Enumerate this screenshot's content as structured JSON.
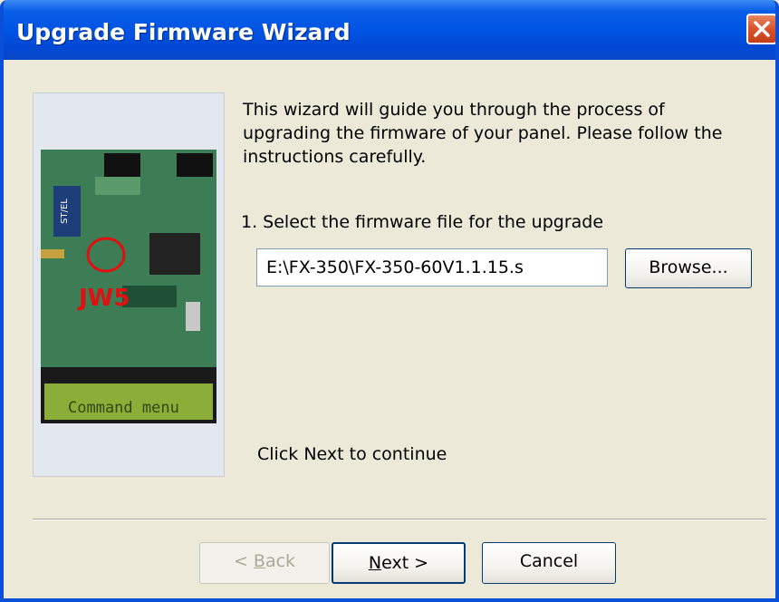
{
  "window": {
    "title": "Upgrade Firmware Wizard"
  },
  "intro": {
    "text": "This wizard will guide you through the process of upgrading the firmware of your panel. Please follow the instructions carefully."
  },
  "step1": {
    "label": "1. Select the firmware file for the upgrade"
  },
  "file_input": {
    "value": "E:\\FX-350\\FX-350-60V1.1.15.s"
  },
  "buttons": {
    "browse": "Browse...",
    "back_accel": "B",
    "back_rest": "ack",
    "back_prefix": "< ",
    "next_accel": "N",
    "next_rest": "ext >",
    "cancel": "Cancel"
  },
  "continue_hint": "Click Next to continue",
  "photo": {
    "jumper_label": "JW5",
    "lcd_text": "Command menu",
    "chip_label": "ST/EL"
  },
  "colors": {
    "title_bar": "#0054E3",
    "close_button": "#D9532C",
    "dialog_bg": "#ECE9D8",
    "highlight_circle": "#E01010"
  }
}
